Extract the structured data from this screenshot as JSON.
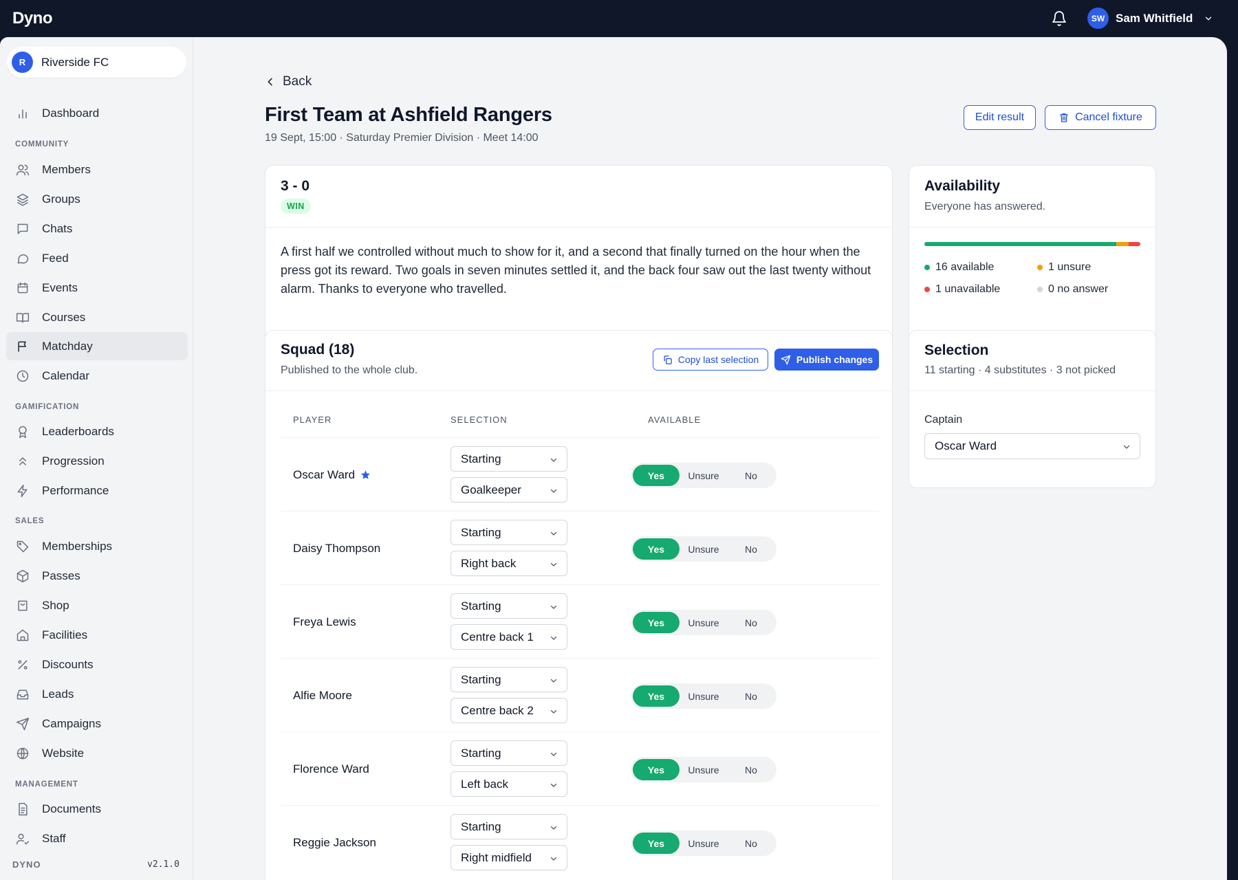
{
  "app": {
    "name": "Dyno",
    "version": "v2.1.0",
    "brand_footer": "DYNO"
  },
  "user": {
    "initials": "SW",
    "name": "Sam Whitfield"
  },
  "org": {
    "initial": "R",
    "name": "Riverside FC"
  },
  "sidebar": {
    "top": [
      {
        "label": "Dashboard",
        "icon": "chart-bar-icon"
      }
    ],
    "sections": [
      {
        "title": "COMMUNITY",
        "items": [
          {
            "label": "Members",
            "icon": "users-icon"
          },
          {
            "label": "Groups",
            "icon": "layers-icon"
          },
          {
            "label": "Chats",
            "icon": "chat-square-icon"
          },
          {
            "label": "Feed",
            "icon": "chat-bubble-icon"
          },
          {
            "label": "Events",
            "icon": "calendar-icon"
          },
          {
            "label": "Courses",
            "icon": "book-icon"
          },
          {
            "label": "Matchday",
            "icon": "flag-icon",
            "active": true
          },
          {
            "label": "Calendar",
            "icon": "clock-icon"
          }
        ]
      },
      {
        "title": "GAMIFICATION",
        "items": [
          {
            "label": "Leaderboards",
            "icon": "award-icon"
          },
          {
            "label": "Progression",
            "icon": "chevrons-up-icon"
          },
          {
            "label": "Performance",
            "icon": "lightning-icon"
          }
        ]
      },
      {
        "title": "SALES",
        "items": [
          {
            "label": "Memberships",
            "icon": "tag-icon"
          },
          {
            "label": "Passes",
            "icon": "package-icon"
          },
          {
            "label": "Shop",
            "icon": "shopping-bag-icon"
          },
          {
            "label": "Facilities",
            "icon": "home-icon"
          },
          {
            "label": "Discounts",
            "icon": "percent-icon"
          },
          {
            "label": "Leads",
            "icon": "inbox-icon"
          },
          {
            "label": "Campaigns",
            "icon": "send-icon"
          },
          {
            "label": "Website",
            "icon": "globe-icon"
          }
        ]
      },
      {
        "title": "MANAGEMENT",
        "items": [
          {
            "label": "Documents",
            "icon": "document-icon"
          },
          {
            "label": "Staff",
            "icon": "user-check-icon"
          }
        ]
      }
    ]
  },
  "page": {
    "back_label": "Back",
    "title": "First Team at Ashfield Rangers",
    "subtitle": "19 Sept, 15:00 · Saturday Premier Division · Meet 14:00",
    "edit_result_label": "Edit result",
    "cancel_fixture_label": "Cancel fixture"
  },
  "result": {
    "score": "3 - 0",
    "outcome": "WIN",
    "report": "A first half we controlled without much to show for it, and a second that finally turned on the hour when the press got its reward. Two goals in seven minutes settled it, and the back four saw out the last twenty without alarm. Thanks to everyone who travelled."
  },
  "availability": {
    "title": "Availability",
    "subtitle": "Everyone has answered.",
    "counts": {
      "available": 16,
      "unsure": 1,
      "unavailable": 1,
      "no_answer": 0
    },
    "labels": {
      "available": "16 available",
      "unsure": "1 unsure",
      "unavailable": "1 unavailable",
      "no_answer": "0 no answer"
    },
    "colors": {
      "available": "#16a970",
      "unsure": "#f59e0b",
      "unavailable": "#ef4444",
      "no_answer": "#d1d5db"
    }
  },
  "squad": {
    "title": "Squad (18)",
    "subtitle": "Published to the whole club.",
    "copy_label": "Copy last selection",
    "publish_label": "Publish changes",
    "columns": {
      "player": "PLAYER",
      "selection": "SELECTION",
      "available": "AVAILABLE"
    },
    "options": {
      "yes": "Yes",
      "unsure": "Unsure",
      "no": "No"
    },
    "players": [
      {
        "name": "Oscar Ward",
        "captain": true,
        "selection": "Starting",
        "position": "Goalkeeper",
        "available": "Yes"
      },
      {
        "name": "Daisy Thompson",
        "captain": false,
        "selection": "Starting",
        "position": "Right back",
        "available": "Yes"
      },
      {
        "name": "Freya Lewis",
        "captain": false,
        "selection": "Starting",
        "position": "Centre back 1",
        "available": "Yes"
      },
      {
        "name": "Alfie Moore",
        "captain": false,
        "selection": "Starting",
        "position": "Centre back 2",
        "available": "Yes"
      },
      {
        "name": "Florence Ward",
        "captain": false,
        "selection": "Starting",
        "position": "Left back",
        "available": "Yes"
      },
      {
        "name": "Reggie Jackson",
        "captain": false,
        "selection": "Starting",
        "position": "Right midfield",
        "available": "Yes"
      }
    ]
  },
  "selection": {
    "title": "Selection",
    "subtitle": "11 starting · 4 substitutes · 3 not picked",
    "captain_label": "Captain",
    "captain_value": "Oscar Ward"
  },
  "colors": {
    "primary": "#2f5fe8",
    "topbar": "#0f1729",
    "success": "#16a970"
  }
}
